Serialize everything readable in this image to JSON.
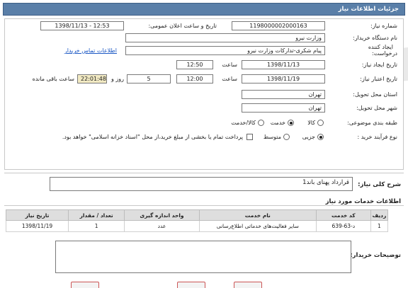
{
  "header": {
    "title": "جزئیات اطلاعات نیاز"
  },
  "form": {
    "need_number_label": "شماره نیاز:",
    "need_number_value": "1198000002000163",
    "announce_label": "تاریخ و ساعت اعلان عمومی:",
    "announce_value": "1398/11/13 - 12:53",
    "buyer_org_label": "نام دستگاه خریدار:",
    "buyer_org_value": "وزارت نیرو",
    "creator_label_1": "ایجاد کننده",
    "creator_label_2": "درخواست:",
    "creator_value": "پیام شکری-تدارکات وزارت نیرو",
    "buyer_contact_link": "اطلاعات تماس خریدار",
    "need_date_label": "تاریخ ایجاد نیاز:",
    "need_date_value": "1398/11/13",
    "need_time_label": "ساعت",
    "need_time_value": "12:50",
    "validity_label": "تاریخ اعتبار نیاز:",
    "validity_date_value": "1398/11/19",
    "validity_time_label": "ساعت",
    "validity_time_value": "12:00",
    "days_value": "5",
    "days_label": "روز و",
    "remaining_time_value": "22:01:48",
    "remaining_label": "ساعت باقی مانده",
    "province_label": "استان محل تحویل:",
    "province_value": "تهران",
    "city_label": "شهر محل تحویل:",
    "city_value": "تهران",
    "category_label": "طبقه بندی موضوعی:",
    "category_options": [
      "کالا",
      "خدمت",
      "کالا/خدمت"
    ],
    "category_selected": "خدمت",
    "purchase_type_label": "نوع فرآیند خرید :",
    "purchase_options": [
      "جزیی",
      "متوسط"
    ],
    "purchase_selected": "جزیی",
    "payment_note": "پرداخت تمام یا بخشی از مبلغ خرید،از محل \"اسناد خزانه اسلامی\" خواهد بود."
  },
  "summary": {
    "label": "شرح کلی نیاز:",
    "value": "قرارداد پهنای باند1"
  },
  "services": {
    "section_title": "اطلاعات خدمات مورد نیاز",
    "columns": [
      "ردیف",
      "کد خدمت",
      "نام خدمت",
      "واحد اندازه گیری",
      "تعداد / مقدار",
      "تاریخ نیاز"
    ],
    "rows": [
      [
        "1",
        "د-63-639",
        "سایر فعالیت‌های خدماتی اطلاع‌رسانی",
        "عدد",
        "1",
        "1398/11/19"
      ]
    ]
  },
  "notes": {
    "label": "توضیحات خریدار:"
  },
  "colors": {
    "header_bg": "#5a7fa8",
    "link": "#1a57c4",
    "remaining_bg": "#f2eac3",
    "table_header_bg": "#dedede"
  }
}
